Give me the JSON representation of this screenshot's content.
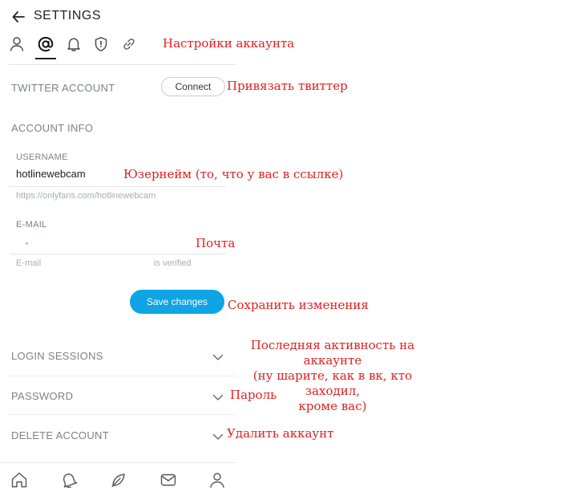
{
  "header": {
    "title": "SETTINGS"
  },
  "tabs": [
    {
      "icon": "user-icon"
    },
    {
      "icon": "at-icon",
      "active": true
    },
    {
      "icon": "bell-icon"
    },
    {
      "icon": "shield-icon"
    },
    {
      "icon": "link-icon"
    }
  ],
  "twitter": {
    "label": "TWITTER ACCOUNT",
    "button": "Connect"
  },
  "account_info": {
    "label": "ACCOUNT INFO",
    "username_label": "USERNAME",
    "username_value": "hotlinewebcam",
    "username_hint": "https://onlyfans.com/hotlinewebcam",
    "email_label": "E-MAIL",
    "email_placeholder": "E-mail",
    "email_status": "is verified"
  },
  "save_button": "Save changes",
  "sections": {
    "login_sessions": "LOGIN SESSIONS",
    "password": "PASSWORD",
    "delete_account": "DELETE ACCOUNT"
  },
  "annotations": {
    "account_settings": "Настройки аккаунта",
    "link_twitter": "Привязать твиттер",
    "username": "Юзернейм (то, что у вас в ссылке)",
    "email": "Почта",
    "save": "Сохранить изменения",
    "sessions_line1": "Последняя активность на аккаунте",
    "sessions_line2": "(ну шарите, как в вк, кто заходил,",
    "sessions_line3": "кроме вас)",
    "password": "Пароль",
    "delete": "Удалить аккаунт"
  },
  "bottom_nav": [
    {
      "icon": "home-icon"
    },
    {
      "icon": "notification-bell-icon"
    },
    {
      "icon": "feather-icon"
    },
    {
      "icon": "message-icon"
    },
    {
      "icon": "profile-icon"
    }
  ],
  "colors": {
    "accent": "#0ea4e6",
    "annotation": "#e02020"
  }
}
